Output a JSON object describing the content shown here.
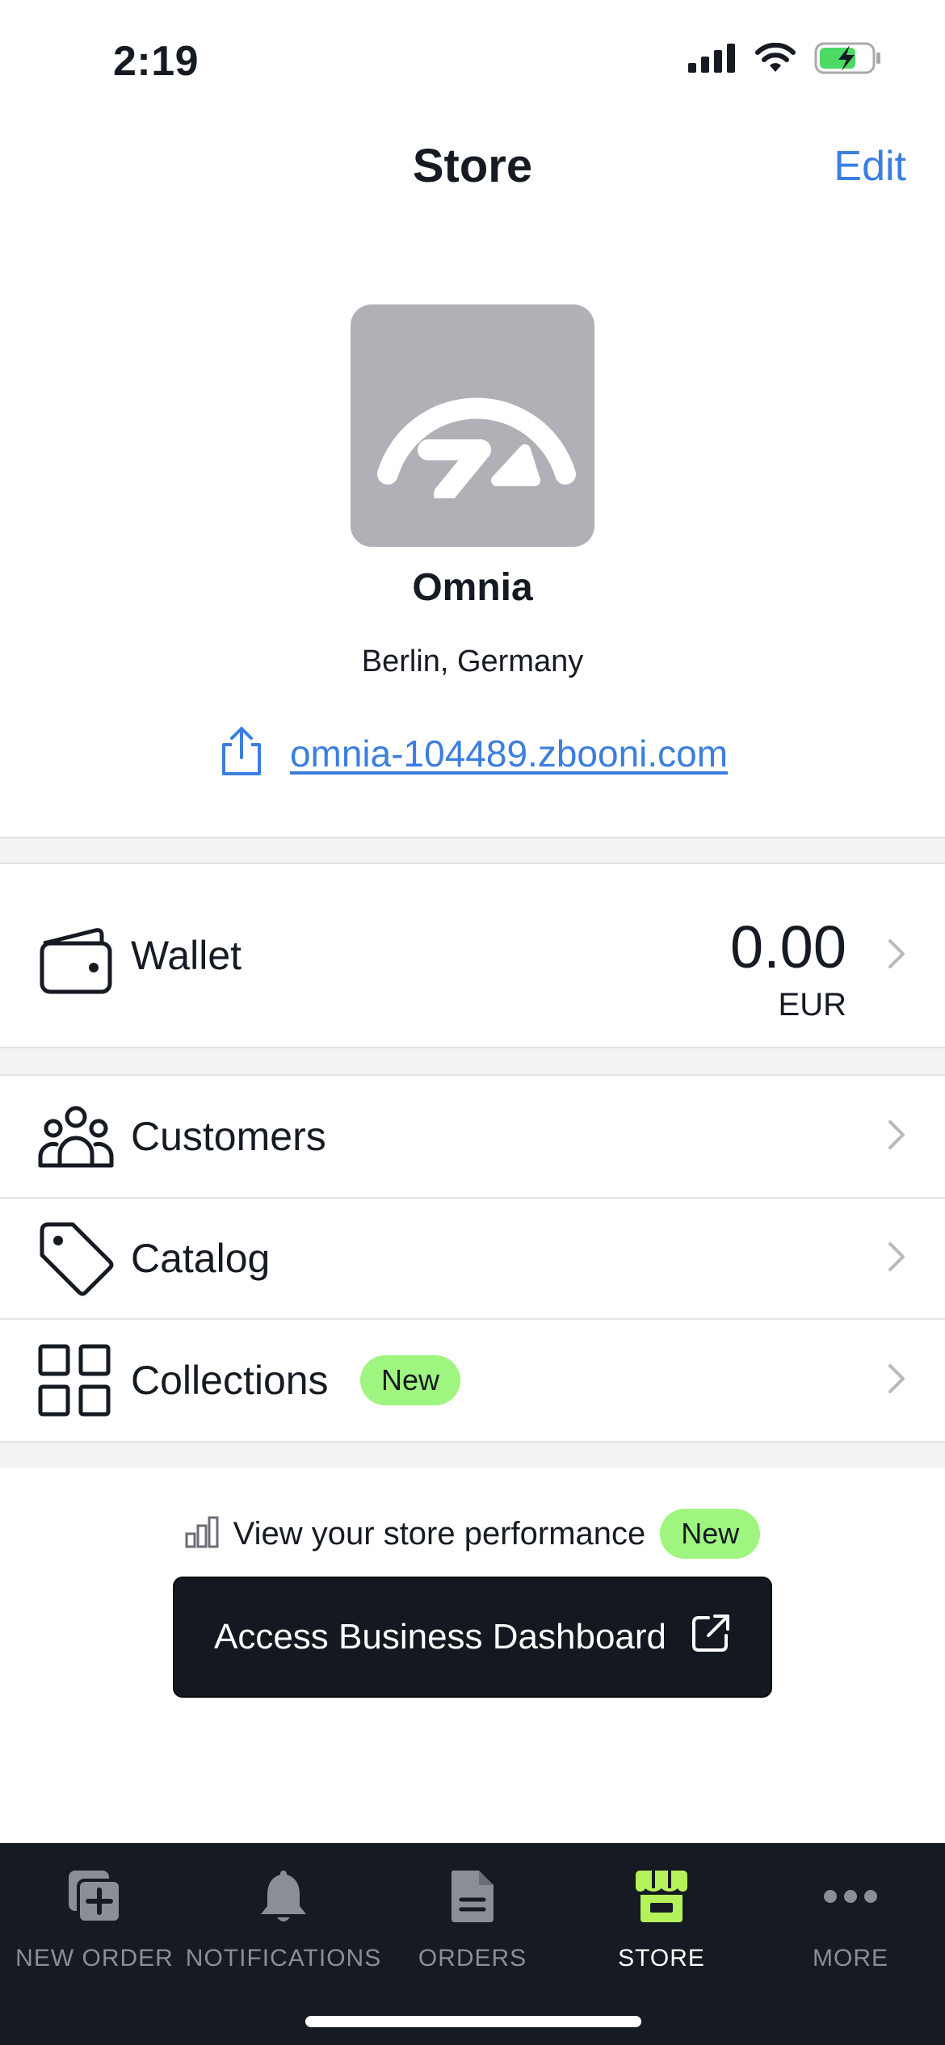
{
  "status_bar": {
    "time": "2:19"
  },
  "header": {
    "title": "Store",
    "edit_label": "Edit"
  },
  "store": {
    "name": "Omnia",
    "location": "Berlin, Germany",
    "url": "omnia-104489.zbooni.com"
  },
  "wallet": {
    "label": "Wallet",
    "amount": "0.00",
    "currency": "EUR"
  },
  "menu": {
    "customers": "Customers",
    "catalog": "Catalog",
    "collections": "Collections",
    "collections_badge": "New"
  },
  "performance": {
    "text": "View your store performance",
    "badge": "New"
  },
  "dashboard_button": {
    "label": "Access Business Dashboard"
  },
  "tabs": [
    {
      "label": "NEW ORDER",
      "icon": "new-order-icon"
    },
    {
      "label": "NOTIFICATIONS",
      "icon": "bell-icon"
    },
    {
      "label": "ORDERS",
      "icon": "document-icon"
    },
    {
      "label": "STORE",
      "icon": "storefront-icon",
      "active": true
    },
    {
      "label": "MORE",
      "icon": "more-dots-icon"
    }
  ],
  "colors": {
    "accent_link": "#3b7ee0",
    "badge_green": "#9ef57f",
    "tab_bar_bg": "#161a22",
    "store_tab_icon": "#b4f25a"
  }
}
